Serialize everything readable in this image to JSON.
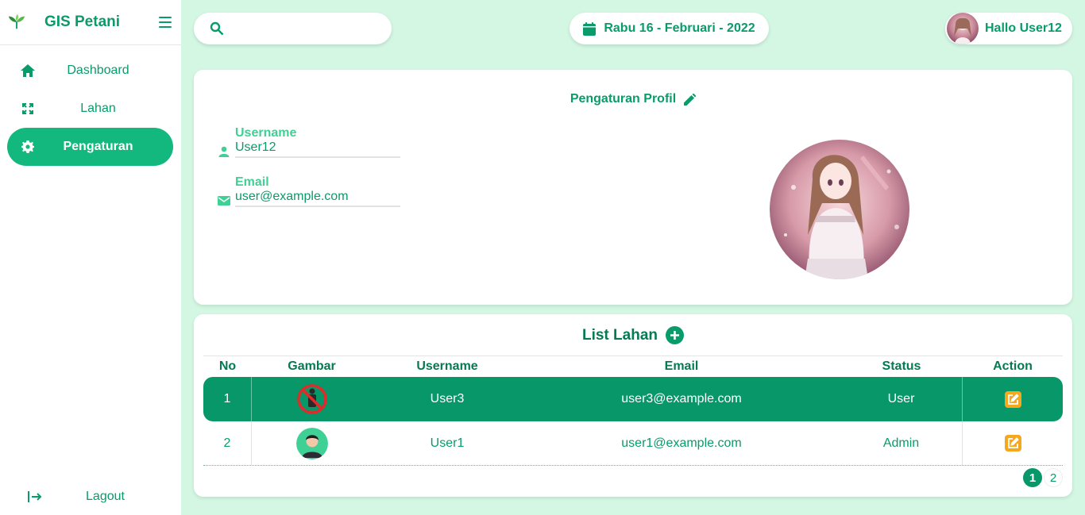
{
  "app": {
    "title": "GIS Petani"
  },
  "sidebar": {
    "items": [
      {
        "label": "Dashboard",
        "icon": "home-icon"
      },
      {
        "label": "Lahan",
        "icon": "expand-icon"
      },
      {
        "label": "Pengaturan",
        "icon": "gear-icon",
        "active": true
      }
    ],
    "logout_label": "Lagout"
  },
  "topbar": {
    "search": {
      "placeholder": "",
      "value": ""
    },
    "date": "Rabu 16 - Februari - 2022",
    "greeting": "Hallo User12"
  },
  "profile": {
    "title": "Pengaturan Profil",
    "username_label": "Username",
    "username_value": "User12",
    "email_label": "Email",
    "email_value": "user@example.com"
  },
  "lahan": {
    "title": "List Lahan",
    "columns": [
      "No",
      "Gambar",
      "Username",
      "Email",
      "Status",
      "Action"
    ],
    "rows": [
      {
        "no": "1",
        "image": "no-person-icon",
        "username": "User3",
        "email": "user3@example.com",
        "status": "User"
      },
      {
        "no": "2",
        "image": "person-avatar-icon",
        "username": "User1",
        "email": "user1@example.com",
        "status": "Admin"
      }
    ],
    "pages": [
      "1",
      "2"
    ],
    "current_page": "1"
  },
  "colors": {
    "primary": "#0a9b6a",
    "accent": "#13b87f",
    "background": "#d3f7e3",
    "edit": "#f5a71e",
    "label": "#3fd095"
  }
}
